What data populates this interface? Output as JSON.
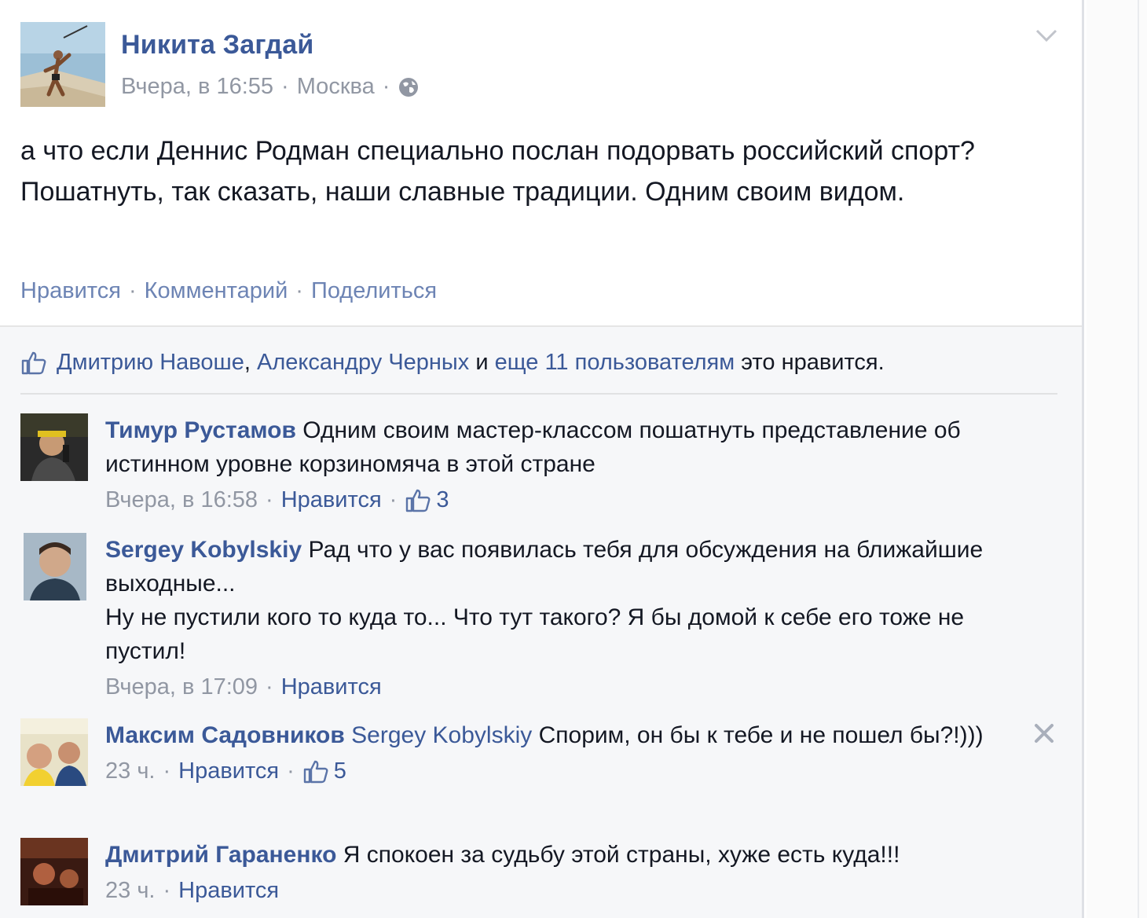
{
  "post": {
    "author": "Никита Загдай",
    "time": "Вчера, в 16:55",
    "location": "Москва",
    "text": "а что если Деннис Родман специально послан подорвать российский спорт? Пошатнуть, так сказать, наши славные традиции. Одним своим видом.",
    "actions": {
      "like": "Нравится",
      "comment": "Комментарий",
      "share": "Поделиться"
    }
  },
  "likes": {
    "user1": "Дмитрию Навоше",
    "comma": ",",
    "user2": "Александру Черных",
    "and": "и",
    "others": "еще 11 пользователям",
    "suffix": "это нравится."
  },
  "comments": [
    {
      "name": "Тимур Рустамов",
      "text": "Одним своим мастер-классом пошатнуть представление об истинном уровне корзиномяча в этой стране",
      "time": "Вчера, в 16:58",
      "like_label": "Нравится",
      "like_count": "3"
    },
    {
      "name": "Sergey Kobylskiy",
      "text": "Рад что у вас появилась тебя для обсуждения на ближайшие выходные...",
      "text2": "Ну не пустили кого то куда то... Что тут такого? Я бы домой к себе его тоже не пустил!",
      "time": "Вчера, в 17:09",
      "like_label": "Нравится"
    },
    {
      "name": "Максим Садовников",
      "mention": "Sergey Kobylskiy",
      "text": "Спорим, он бы к тебе и не пошел бы?!)))",
      "time": "23 ч.",
      "like_label": "Нравится",
      "like_count": "5"
    },
    {
      "name": "Дмитрий Гараненко",
      "text": "Я спокоен за судьбу этой страны, хуже есть куда!!!",
      "time": "23 ч.",
      "like_label": "Нравится"
    }
  ],
  "colors": {
    "link": "#3b5998",
    "meta": "#9197a3",
    "comment_bg": "#f6f7f9"
  },
  "icons": [
    "globe-icon",
    "chevron-down-icon",
    "thumbs-up-icon",
    "close-icon"
  ]
}
